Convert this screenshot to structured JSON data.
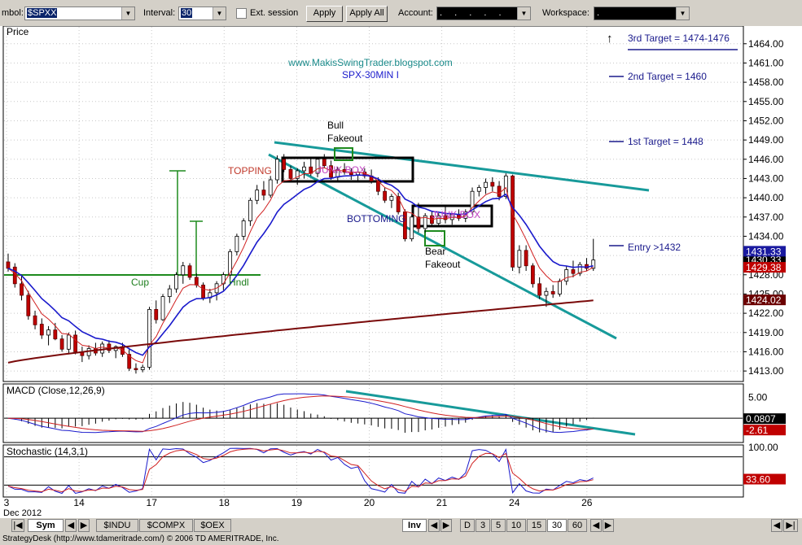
{
  "toolbar": {
    "symbol_label": "mbol:",
    "symbol_value": "$SPXX",
    "interval_label": "Interval:",
    "interval_value": "30",
    "ext_session_label": "Ext. session",
    "apply_label": "Apply",
    "apply_all_label": "Apply All",
    "account_label": "Account:",
    "account_value": ". . . . .",
    "workspace_label": "Workspace:",
    "workspace_value": "."
  },
  "chart_data": [
    {
      "type": "candlestick",
      "panel": "price",
      "title": "Price",
      "watermark": [
        "www.MakisSwingTrader.blogspot.com",
        "SPX-30MIN I"
      ],
      "y_ticks": [
        1413.0,
        1416.0,
        1419.0,
        1422.0,
        1425.0,
        1428.0,
        1431.0,
        1434.0,
        1437.0,
        1440.0,
        1443.0,
        1446.0,
        1449.0,
        1452.0,
        1455.0,
        1458.0,
        1461.0,
        1464.0
      ],
      "y_range": [
        1412,
        1466
      ],
      "price_labels": [
        {
          "value": "1430.33",
          "bg": "#000000",
          "fg": "#ffffff",
          "y": 1430.33
        },
        {
          "value": "1424.02",
          "bg": "#6b0000",
          "fg": "#ffffff",
          "y": 1424.02
        },
        {
          "value": "1431.33",
          "bg": "#1a1aa0",
          "fg": "#ffffff",
          "y": 1431.6
        },
        {
          "value": "1429.38",
          "bg": "#c00000",
          "fg": "#ffffff",
          "y": 1429.1
        }
      ],
      "annotations": [
        {
          "text": "3rd Target = 1474-1476",
          "y": 1464.3,
          "color": "#1a1a8c"
        },
        {
          "text": "2nd Target = 1460",
          "y": 1459.3,
          "color": "#1a1a8c"
        },
        {
          "text": "1st Target = 1448",
          "y": 1449.2,
          "color": "#1a1a8c"
        },
        {
          "text": "Entry >1432",
          "y": 1432.3,
          "color": "#1a1a8c"
        },
        {
          "text": "TOPPING",
          "color": "#c0392b"
        },
        {
          "text": "BOTTOMING",
          "color": "#1a1a8c"
        },
        {
          "text": "Cup",
          "color": "#1e7e1e"
        },
        {
          "text": "Hndl",
          "color": "#1e7e1e"
        },
        {
          "text": "Bull",
          "color": "#000000"
        },
        {
          "text": "Fakeout",
          "color": "#000000"
        },
        {
          "text": "Bear",
          "color": "#000000"
        },
        {
          "text": "Fakeout",
          "color": "#000000"
        },
        {
          "text": "JUNK BOX",
          "color": "#c040c0"
        },
        {
          "text": "JUNK BOX",
          "color": "#c040c0"
        }
      ],
      "candles": [
        [
          1430.0,
          1431.3,
          1428.5,
          1429.0
        ],
        [
          1429.2,
          1429.8,
          1426.0,
          1426.6
        ],
        [
          1426.6,
          1428.0,
          1424.0,
          1424.8
        ],
        [
          1424.8,
          1425.5,
          1421.0,
          1421.6
        ],
        [
          1421.6,
          1422.4,
          1419.5,
          1420.2
        ],
        [
          1420.3,
          1421.2,
          1418.0,
          1418.6
        ],
        [
          1418.6,
          1420.0,
          1417.0,
          1419.4
        ],
        [
          1419.4,
          1420.5,
          1417.8,
          1418.0
        ],
        [
          1418.0,
          1418.6,
          1416.0,
          1416.4
        ],
        [
          1416.4,
          1419.0,
          1415.6,
          1418.6
        ],
        [
          1418.6,
          1419.3,
          1415.6,
          1416.0
        ],
        [
          1416.0,
          1416.8,
          1414.4,
          1415.4
        ],
        [
          1415.4,
          1417.0,
          1414.8,
          1416.5
        ],
        [
          1416.5,
          1417.4,
          1415.4,
          1415.8
        ],
        [
          1415.8,
          1417.6,
          1415.2,
          1417.2
        ],
        [
          1417.2,
          1417.8,
          1415.8,
          1416.2
        ],
        [
          1416.2,
          1417.0,
          1415.0,
          1416.8
        ],
        [
          1416.8,
          1417.4,
          1415.2,
          1415.6
        ],
        [
          1415.6,
          1416.6,
          1413.0,
          1413.4
        ],
        [
          1413.4,
          1414.2,
          1412.6,
          1413.2
        ],
        [
          1413.2,
          1414.0,
          1412.8,
          1413.6
        ],
        [
          1413.6,
          1423.0,
          1413.2,
          1422.6
        ],
        [
          1422.6,
          1424.0,
          1420.4,
          1421.0
        ],
        [
          1421.0,
          1425.0,
          1420.8,
          1424.6
        ],
        [
          1424.6,
          1426.4,
          1423.6,
          1425.8
        ],
        [
          1425.8,
          1428.4,
          1425.2,
          1428.0
        ],
        [
          1428.0,
          1430.0,
          1426.6,
          1429.4
        ],
        [
          1429.4,
          1429.8,
          1427.2,
          1427.6
        ],
        [
          1427.6,
          1428.2,
          1426.0,
          1426.4
        ],
        [
          1426.4,
          1426.8,
          1424.0,
          1424.4
        ],
        [
          1424.4,
          1425.8,
          1423.6,
          1425.2
        ],
        [
          1425.2,
          1427.0,
          1424.0,
          1426.6
        ],
        [
          1426.6,
          1428.4,
          1425.6,
          1428.0
        ],
        [
          1428.0,
          1432.0,
          1427.4,
          1431.6
        ],
        [
          1431.6,
          1434.4,
          1431.0,
          1434.0
        ],
        [
          1434.0,
          1436.8,
          1433.4,
          1436.4
        ],
        [
          1436.4,
          1440.0,
          1435.6,
          1439.6
        ],
        [
          1439.6,
          1442.0,
          1439.0,
          1441.2
        ],
        [
          1441.2,
          1442.6,
          1439.6,
          1440.4
        ],
        [
          1440.4,
          1443.4,
          1440.0,
          1442.8
        ],
        [
          1442.8,
          1446.6,
          1442.2,
          1446.0
        ],
        [
          1446.0,
          1446.8,
          1444.0,
          1444.4
        ],
        [
          1444.4,
          1445.0,
          1442.4,
          1443.0
        ],
        [
          1443.0,
          1444.6,
          1442.0,
          1444.2
        ],
        [
          1444.2,
          1445.6,
          1443.0,
          1444.8
        ],
        [
          1444.8,
          1446.2,
          1443.4,
          1443.8
        ],
        [
          1443.8,
          1446.2,
          1443.2,
          1446.0
        ],
        [
          1446.0,
          1446.8,
          1444.6,
          1445.0
        ],
        [
          1445.0,
          1445.8,
          1442.8,
          1443.2
        ],
        [
          1443.2,
          1444.8,
          1442.6,
          1444.4
        ],
        [
          1444.4,
          1445.4,
          1443.6,
          1444.0
        ],
        [
          1444.0,
          1444.6,
          1442.8,
          1443.6
        ],
        [
          1443.6,
          1444.4,
          1442.6,
          1444.0
        ],
        [
          1444.0,
          1444.6,
          1443.0,
          1443.4
        ],
        [
          1443.4,
          1444.4,
          1442.2,
          1442.6
        ],
        [
          1442.6,
          1443.2,
          1440.4,
          1441.0
        ],
        [
          1441.0,
          1441.6,
          1439.2,
          1439.6
        ],
        [
          1439.6,
          1440.6,
          1438.4,
          1440.2
        ],
        [
          1440.2,
          1440.8,
          1437.4,
          1437.8
        ],
        [
          1437.8,
          1438.2,
          1433.2,
          1433.6
        ],
        [
          1433.6,
          1437.4,
          1433.2,
          1437.0
        ],
        [
          1437.0,
          1439.2,
          1434.6,
          1435.2
        ],
        [
          1435.2,
          1437.6,
          1434.6,
          1437.2
        ],
        [
          1437.2,
          1437.8,
          1435.6,
          1436.0
        ],
        [
          1436.0,
          1437.6,
          1435.4,
          1437.2
        ],
        [
          1437.2,
          1438.6,
          1436.0,
          1436.6
        ],
        [
          1436.6,
          1437.6,
          1435.8,
          1437.4
        ],
        [
          1437.4,
          1438.2,
          1436.4,
          1436.8
        ],
        [
          1436.8,
          1438.2,
          1436.2,
          1437.8
        ],
        [
          1437.8,
          1441.6,
          1437.4,
          1441.0
        ],
        [
          1441.0,
          1442.0,
          1440.2,
          1441.6
        ],
        [
          1441.6,
          1443.0,
          1440.6,
          1442.4
        ],
        [
          1442.4,
          1443.2,
          1441.0,
          1441.8
        ],
        [
          1441.8,
          1442.6,
          1439.6,
          1440.2
        ],
        [
          1440.2,
          1443.8,
          1439.8,
          1443.4
        ],
        [
          1443.4,
          1443.6,
          1428.6,
          1429.2
        ],
        [
          1429.2,
          1432.6,
          1428.2,
          1431.8
        ],
        [
          1431.8,
          1432.6,
          1428.6,
          1429.4
        ],
        [
          1429.4,
          1429.8,
          1426.0,
          1426.6
        ],
        [
          1426.6,
          1427.6,
          1424.2,
          1424.8
        ],
        [
          1424.8,
          1426.0,
          1423.0,
          1425.4
        ],
        [
          1425.4,
          1426.4,
          1424.4,
          1425.0
        ],
        [
          1425.0,
          1427.4,
          1424.6,
          1427.0
        ],
        [
          1427.0,
          1429.4,
          1426.4,
          1428.8
        ],
        [
          1428.8,
          1430.2,
          1427.6,
          1428.2
        ],
        [
          1428.2,
          1430.0,
          1427.8,
          1429.6
        ],
        [
          1429.6,
          1430.6,
          1428.6,
          1429.0
        ],
        [
          1429.0,
          1433.6,
          1428.6,
          1430.3
        ]
      ],
      "x_ticks": [
        {
          "label": "3",
          "bar": 0
        },
        {
          "label": "14",
          "bar": 10
        },
        {
          "label": "17",
          "bar": 20
        },
        {
          "label": "18",
          "bar": 30
        },
        {
          "label": "19",
          "bar": 40
        },
        {
          "label": "20",
          "bar": 50
        },
        {
          "label": "21",
          "bar": 60
        },
        {
          "label": "24",
          "bar": 70
        },
        {
          "label": "26",
          "bar": 80
        }
      ],
      "x_sublabel": "Dec 2012"
    },
    {
      "type": "line",
      "panel": "macd",
      "title": "MACD (Close,12,26,9)",
      "y_ticks": [
        5.0
      ],
      "y_tick_labels": [
        "5.00"
      ],
      "price_labels": [
        {
          "value": "0.0807",
          "bg": "#000000",
          "fg": "#ffffff"
        },
        {
          "value": "-2.61",
          "bg": "#c00000",
          "fg": "#ffffff"
        }
      ]
    },
    {
      "type": "line",
      "panel": "stochastic",
      "title": "Stochastic (14,3,1)",
      "y_ticks": [
        100
      ],
      "y_tick_labels": [
        "100.00"
      ],
      "price_labels": [
        {
          "value": "33.60",
          "bg": "#c00000",
          "fg": "#ffffff"
        }
      ]
    }
  ],
  "tabs": {
    "sym": "Sym",
    "indu": "$INDU",
    "compx": "$COMPX",
    "oex": "$OEX",
    "inv": "Inv",
    "intervals": [
      "D",
      "3",
      "5",
      "10",
      "15",
      "30",
      "60"
    ]
  },
  "status": "StrategyDesk (http://www.tdameritrade.com/) © 2006 TD AMERITRADE, Inc.",
  "colors": {
    "blue_ma": "#1a1acc",
    "red_ma": "#d02020",
    "maroon_ma": "#7a0a0a",
    "teal_trend": "#179a9a",
    "green_cup": "#1e8a1e"
  }
}
